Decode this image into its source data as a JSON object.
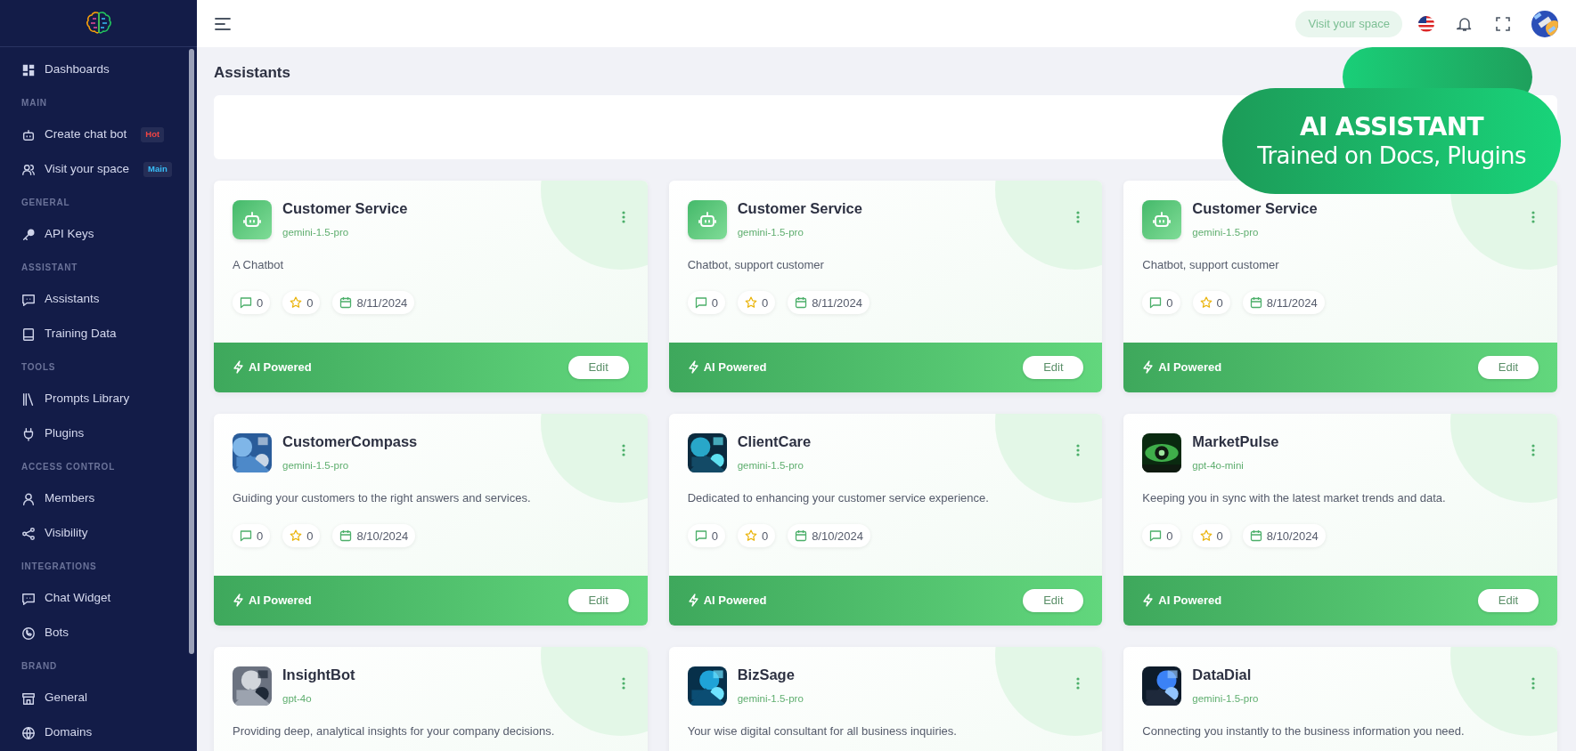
{
  "topbar": {
    "visit_button": "Visit your space"
  },
  "sidebar": {
    "entries": [
      {
        "kind": "item",
        "label": "Dashboards"
      },
      {
        "kind": "heading",
        "label": "MAIN"
      },
      {
        "kind": "item",
        "label": "Create chat bot",
        "badge": {
          "text": "Hot",
          "color": "#ef4444"
        }
      },
      {
        "kind": "item",
        "label": "Visit your space",
        "badge": {
          "text": "Main",
          "color": "#38bdf8"
        }
      },
      {
        "kind": "heading",
        "label": "GENERAL"
      },
      {
        "kind": "item",
        "label": "API Keys"
      },
      {
        "kind": "heading",
        "label": "ASSISTANT"
      },
      {
        "kind": "item",
        "label": "Assistants"
      },
      {
        "kind": "item",
        "label": "Training Data"
      },
      {
        "kind": "heading",
        "label": "TOOLS"
      },
      {
        "kind": "item",
        "label": "Prompts Library"
      },
      {
        "kind": "item",
        "label": "Plugins"
      },
      {
        "kind": "heading",
        "label": "ACCESS CONTROL"
      },
      {
        "kind": "item",
        "label": "Members"
      },
      {
        "kind": "item",
        "label": "Visibility"
      },
      {
        "kind": "heading",
        "label": "INTEGRATIONS"
      },
      {
        "kind": "item",
        "label": "Chat Widget"
      },
      {
        "kind": "item",
        "label": "Bots"
      },
      {
        "kind": "heading",
        "label": "BRAND"
      },
      {
        "kind": "item",
        "label": "General"
      },
      {
        "kind": "item",
        "label": "Domains"
      }
    ]
  },
  "page_title": "Assistants",
  "promo": {
    "title": "AI ASSISTANT",
    "subtitle": "Trained on Docs, Plugins"
  },
  "cards": [
    {
      "avatar": {
        "kind": "icon"
      },
      "name": "Customer Service",
      "model": "gemini-1.5-pro",
      "description": "A Chatbot",
      "comments": "0",
      "stars": "0",
      "date": "8/11/2024",
      "footer": "AI Powered",
      "edit": "Edit"
    },
    {
      "avatar": {
        "kind": "icon"
      },
      "name": "Customer Service",
      "model": "gemini-1.5-pro",
      "description": "Chatbot, support customer",
      "comments": "0",
      "stars": "0",
      "date": "8/11/2024",
      "footer": "AI Powered",
      "edit": "Edit"
    },
    {
      "avatar": {
        "kind": "icon"
      },
      "name": "Customer Service",
      "model": "gemini-1.5-pro",
      "description": "Chatbot, support customer",
      "comments": "0",
      "stars": "0",
      "date": "8/11/2024",
      "footer": "AI Powered",
      "edit": "Edit"
    },
    {
      "name": "CustomerCompass",
      "model": "gemini-1.5-pro",
      "description": "Guiding your customers to the right answers and services.",
      "comments": "0",
      "stars": "0",
      "date": "8/10/2024",
      "footer": "AI Powered",
      "edit": "Edit"
    },
    {
      "name": "ClientCare",
      "model": "gemini-1.5-pro",
      "description": "Dedicated to enhancing your customer service experience.",
      "comments": "0",
      "stars": "0",
      "date": "8/10/2024",
      "footer": "AI Powered",
      "edit": "Edit"
    },
    {
      "name": "MarketPulse",
      "model": "gpt-4o-mini",
      "description": "Keeping you in sync with the latest market trends and data.",
      "comments": "0",
      "stars": "0",
      "date": "8/10/2024",
      "footer": "AI Powered",
      "edit": "Edit"
    },
    {
      "name": "InsightBot",
      "model": "gpt-4o",
      "description": "Providing deep, analytical insights for your company decisions."
    },
    {
      "name": "BizSage",
      "model": "gemini-1.5-pro",
      "description": "Your wise digital consultant for all business inquiries."
    },
    {
      "name": "DataDial",
      "model": "gemini-1.5-pro",
      "description": "Connecting you instantly to the business information you need."
    }
  ]
}
